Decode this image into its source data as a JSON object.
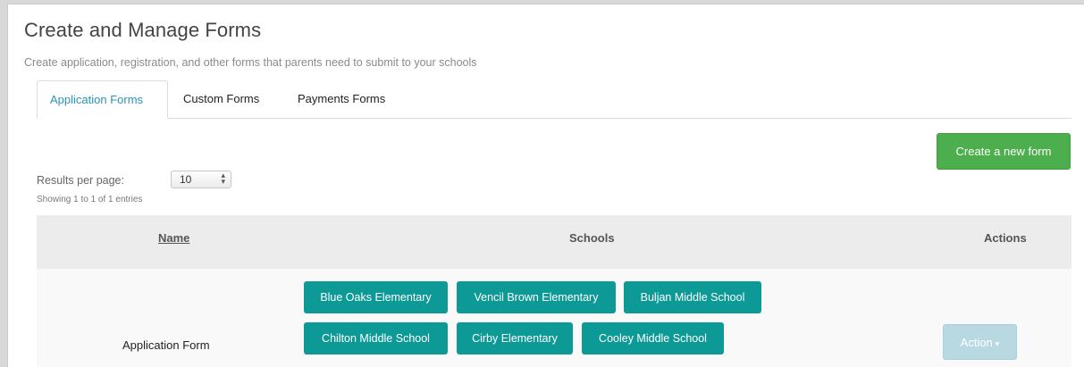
{
  "header": {
    "title": "Create and Manage Forms",
    "subtitle": "Create application, registration, and other forms that parents need to submit to your schools"
  },
  "tabs": [
    {
      "label": "Application Forms",
      "active": true
    },
    {
      "label": "Custom Forms",
      "active": false
    },
    {
      "label": "Payments Forms",
      "active": false
    }
  ],
  "toolbar": {
    "create_label": "Create a new form"
  },
  "pagination": {
    "results_label": "Results per page:",
    "per_page_value": "10",
    "showing_text": "Showing 1 to 1 of 1 entries"
  },
  "table": {
    "headers": {
      "name": "Name",
      "schools": "Schools",
      "actions": "Actions"
    },
    "rows": [
      {
        "name": "Application Form",
        "schools": [
          "Blue Oaks Elementary",
          "Vencil Brown Elementary",
          "Buljan Middle School",
          "Chilton Middle School",
          "Cirby Elementary",
          "Cooley Middle School"
        ],
        "action_label": "Action",
        "action_caret": "▾"
      }
    ]
  },
  "colors": {
    "accent_tab": "#2a95b5",
    "create_button": "#4cae4c",
    "school_tag": "#0d9a97",
    "action_button": "#b8d9e2"
  },
  "icons": {
    "select_arrows": "⇕"
  }
}
